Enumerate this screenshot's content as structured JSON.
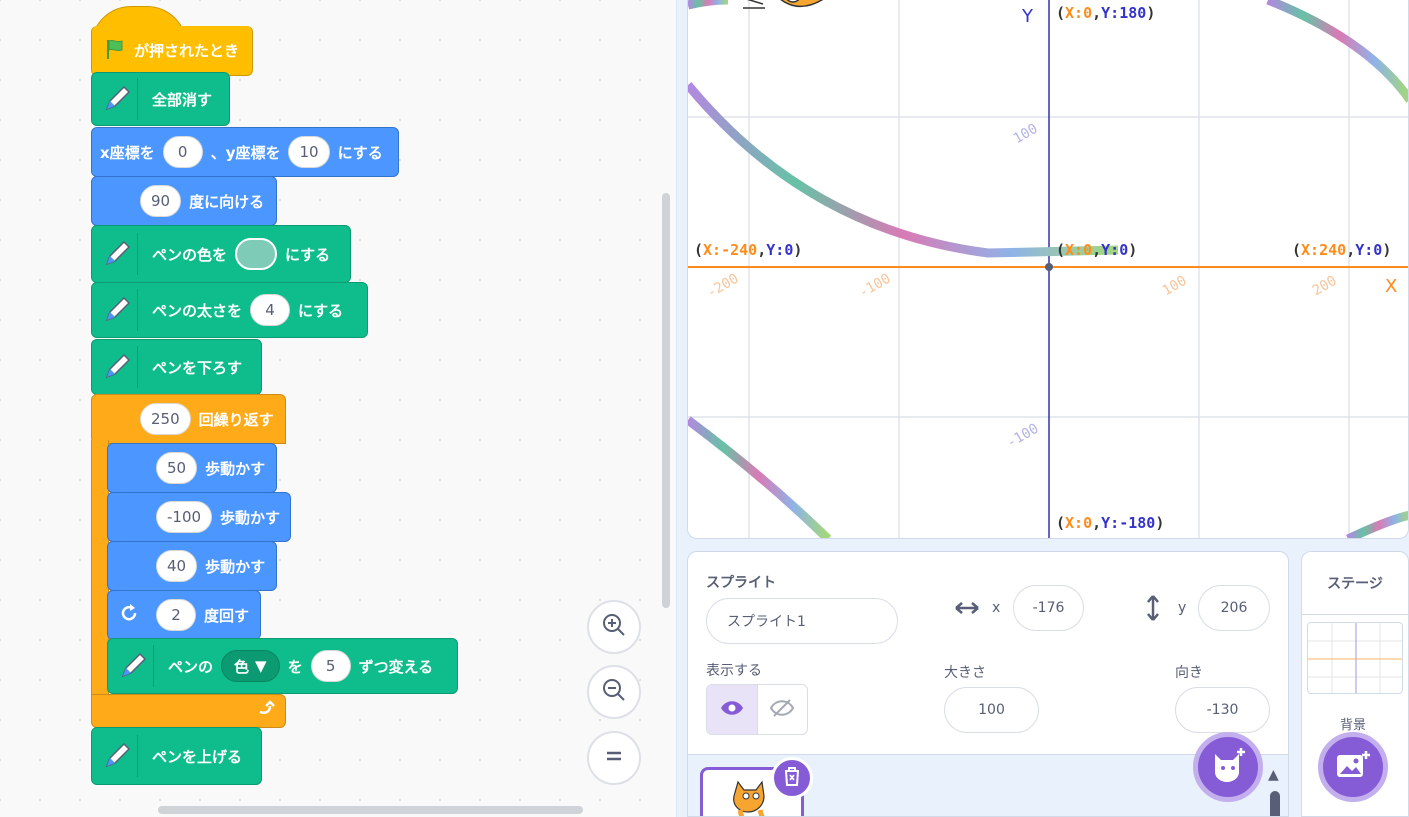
{
  "blocks": {
    "hat": "が押されたとき",
    "clear": "全部消す",
    "goto_x_label": "x座標を",
    "goto_x_value": "0",
    "goto_sep": "、y座標を",
    "goto_y_value": "10",
    "goto_suffix": "にする",
    "point_value": "90",
    "point_label": "度に向ける",
    "pen_color_label": "ペンの色を",
    "pen_color_suffix": "にする",
    "pen_color_hex": "#7ecbb8",
    "pen_size_label": "ペンの太さを",
    "pen_size_value": "4",
    "pen_size_suffix": "にする",
    "pen_down": "ペンを下ろす",
    "repeat_value": "250",
    "repeat_label": "回繰り返す",
    "move1_value": "50",
    "move2_value": "-100",
    "move3_value": "40",
    "move_label": "歩動かす",
    "turn_value": "2",
    "turn_label": "度回す",
    "change_prefix": "ペンの",
    "change_param": "色",
    "change_mid": "を",
    "change_value": "5",
    "change_suffix": "ずつ変える",
    "pen_up": "ペンを上げる"
  },
  "stage": {
    "y_axis": "Y",
    "x_axis": "X",
    "top": {
      "x": "0",
      "y": "180"
    },
    "left": {
      "x": "-240",
      "y": "0"
    },
    "center": {
      "x": "0",
      "y": "0"
    },
    "right": {
      "x": "240",
      "y": "0"
    },
    "bottom": {
      "x": "0",
      "y": "-180"
    },
    "ticks_x": [
      "-200",
      "-100",
      "100",
      "200"
    ],
    "ticks_y": [
      "100",
      "-100"
    ]
  },
  "sprite": {
    "title": "スプライト",
    "name": "スプライト1",
    "x_label": "x",
    "x_value": "-176",
    "y_label": "y",
    "y_value": "206",
    "show_label": "表示する",
    "size_label": "大きさ",
    "size_value": "100",
    "direction_label": "向き",
    "direction_value": "-130"
  },
  "stage_panel": {
    "title": "ステージ",
    "backdrop_label": "背景"
  },
  "colors": {
    "accent": "#855cd6",
    "pen_green": "#0fbd8c",
    "motion_blue": "#4c97ff",
    "control_orange": "#ffab19"
  }
}
